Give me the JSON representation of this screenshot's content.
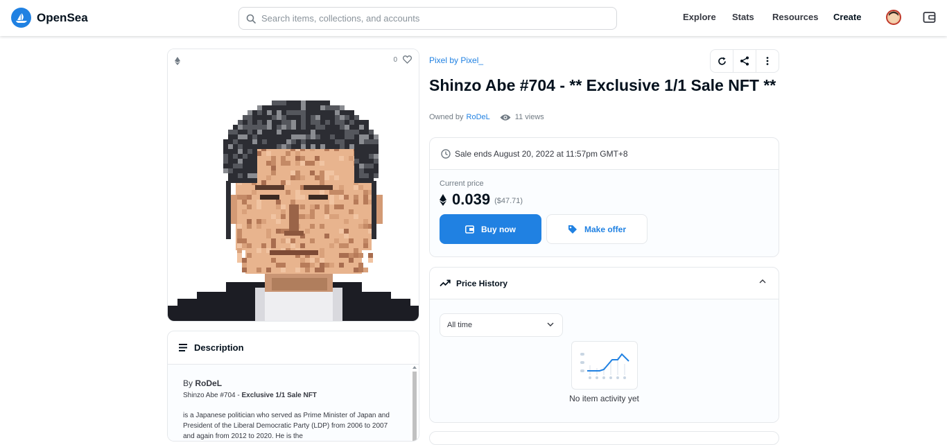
{
  "nav": {
    "brand": "OpenSea",
    "search_placeholder": "Search items, collections, and accounts",
    "links": [
      "Explore",
      "Stats",
      "Resources",
      "Create"
    ]
  },
  "item": {
    "favorites": "0",
    "collection": "Pixel by Pixel_",
    "title": "Shinzo Abe #704 - ** Exclusive 1/1 Sale NFT **",
    "owned_by_label": "Owned by",
    "owner": "RoDeL",
    "views": "11 views"
  },
  "sale": {
    "ends": "Sale ends August 20, 2022 at 11:57pm GMT+8",
    "current_price_label": "Current price",
    "price": "0.039",
    "price_usd": "($47.71)",
    "buy_label": "Buy now",
    "offer_label": "Make offer"
  },
  "price_history": {
    "title": "Price History",
    "range": "All time",
    "empty": "No item activity yet"
  },
  "description": {
    "title": "Description",
    "by_prefix": "By",
    "by_name": "RoDeL",
    "subtitle_plain": "Shinzo Abe #704 - ",
    "subtitle_bold": "Exclusive 1/1 Sale NFT",
    "body": "is a Japanese politician who served as Prime Minister of Japan and President of the Liberal Democratic Party (LDP) from 2006 to 2007 and again from 2012 to 2020. He is the"
  },
  "colors": {
    "accent": "#2081e2",
    "text": "#04111d",
    "muted": "#707a83",
    "border": "#e5e8eb"
  }
}
